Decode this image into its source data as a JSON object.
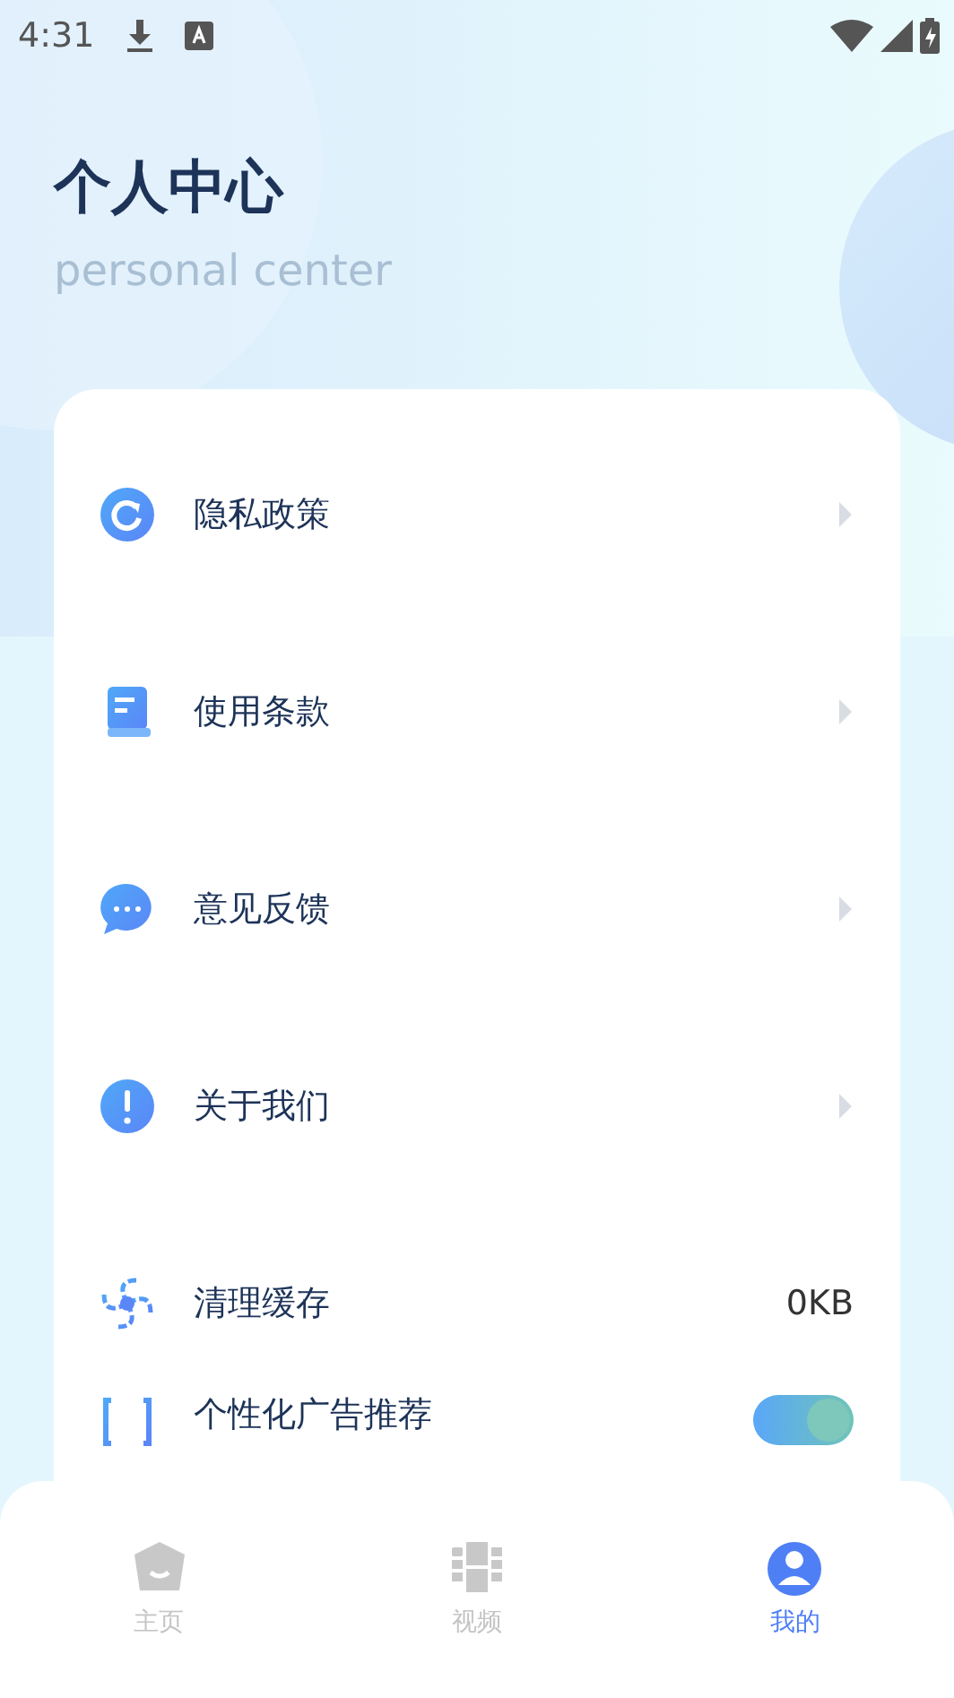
{
  "status_bar": {
    "time": "4:31"
  },
  "header": {
    "title": "个人中心",
    "subtitle": "personal center"
  },
  "menu": [
    {
      "kind": "arrow",
      "label": "隐私政策"
    },
    {
      "kind": "arrow",
      "label": "使用条款"
    },
    {
      "kind": "arrow",
      "label": "意见反馈"
    },
    {
      "kind": "arrow",
      "label": "关于我们"
    },
    {
      "kind": "value",
      "label": "清理缓存",
      "value": "0KB"
    },
    {
      "kind": "switch",
      "label": "个性化广告推荐",
      "on": true
    }
  ],
  "tabs": [
    {
      "label": "主页",
      "selected": false
    },
    {
      "label": "视频",
      "selected": false
    },
    {
      "label": "我的",
      "selected": true
    }
  ]
}
